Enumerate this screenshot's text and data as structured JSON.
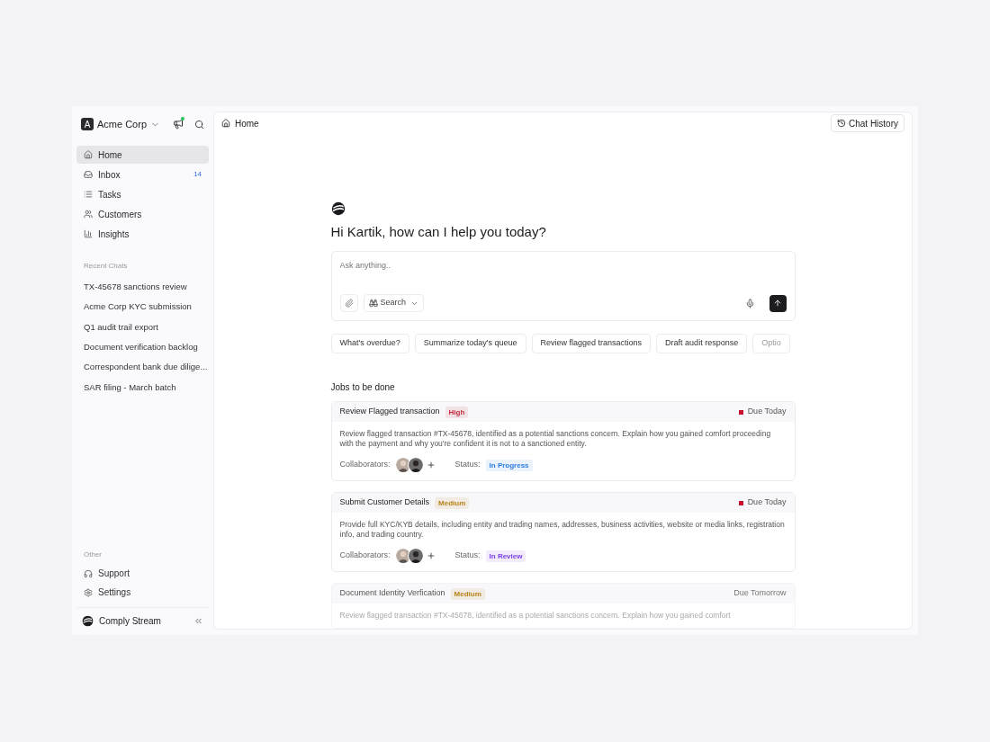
{
  "workspace": {
    "name": "Acme Corp",
    "initial": "A",
    "notification": true
  },
  "nav": [
    {
      "label": "Home",
      "selected": true
    },
    {
      "label": "Inbox",
      "selected": false,
      "count": "14"
    },
    {
      "label": "Tasks",
      "selected": false
    },
    {
      "label": "Customers",
      "selected": false
    },
    {
      "label": "Insights",
      "selected": false
    }
  ],
  "recent_chats": {
    "title": "Recent Chats",
    "items": [
      "TX-45678 sanctions review",
      "Acme Corp KYC submission",
      "Q1 audit trail export",
      "Document verification backlog",
      "Correspondent bank due dilige...",
      "SAR filing - March batch"
    ]
  },
  "other": {
    "title": "Other",
    "items": [
      {
        "label": "Support"
      },
      {
        "label": "Settings"
      }
    ]
  },
  "brand": {
    "name": "Comply Stream"
  },
  "breadcrumb": "Home",
  "chat_history_button": "Chat History",
  "greeting": "Hi Kartik, how can I help you today?",
  "prompt": {
    "placeholder": "Ask anything..",
    "search_label": "Search"
  },
  "suggestions": [
    "What's overdue?",
    "Summarize today's queue",
    "Review flagged transactions",
    "Draft audit response",
    "Optio"
  ],
  "jobs": {
    "title": "Jobs to be done",
    "items": [
      {
        "title": "Review Flagged transaction",
        "priority": {
          "label": "High",
          "color": "#c62a3e"
        },
        "due": "Due Today",
        "urgent": true,
        "description": "Review flagged transaction #TX-45678, identified as a potential sanctions concern. Explain how you gained comfort proceeding with the payment and why you're confident it is not to a sanctioned entity.",
        "collaborators_label": "Collaborators:",
        "status_label": "Status:",
        "status": {
          "label": "In Progress",
          "color": "#2f7de1"
        }
      },
      {
        "title": "Submit Customer Details",
        "priority": {
          "label": "Medium",
          "color": "#b8841a"
        },
        "due": "Due Today",
        "urgent": true,
        "description": "Provide full KYC/KYB details, including entity and trading names, addresses, business activities, website or media links, registration info, and trading country.",
        "collaborators_label": "Collaborators:",
        "status_label": "Status:",
        "status": {
          "label": "In Review",
          "color": "#7b3fe4"
        }
      },
      {
        "title": "Document Identity Verfication",
        "priority": {
          "label": "Medium",
          "color": "#b8841a"
        },
        "due": "Due Tomorrow",
        "urgent": false,
        "description": "Review flagged transaction #TX-45678, identified as a potential sanctions concern. Explain how you gained comfort"
      }
    ]
  }
}
